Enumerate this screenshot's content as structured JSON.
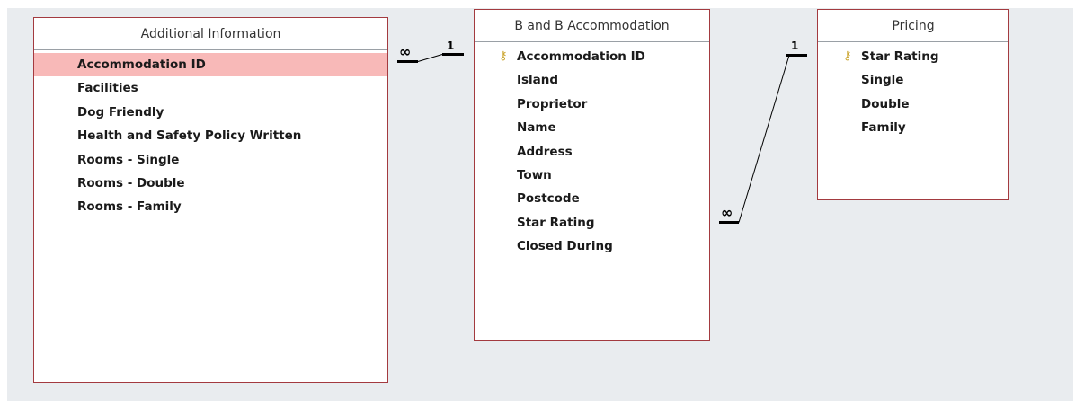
{
  "colors": {
    "canvas_bg": "#e9ecef",
    "table_border": "#a33a3f",
    "selected_row": "#f8b9b8",
    "key_icon": "#c9a227"
  },
  "tables": [
    {
      "title": "Additional Information",
      "fields": [
        {
          "name": "Accommodation ID",
          "selected": true
        },
        {
          "name": "Facilities"
        },
        {
          "name": "Dog Friendly"
        },
        {
          "name": "Health and Safety Policy Written"
        },
        {
          "name": "Rooms - Single"
        },
        {
          "name": "Rooms - Double"
        },
        {
          "name": "Rooms - Family"
        }
      ]
    },
    {
      "title": "B and B Accommodation",
      "fields": [
        {
          "name": "Accommodation ID",
          "primary_key": true,
          "icon": "key-icon"
        },
        {
          "name": "Island"
        },
        {
          "name": "Proprietor"
        },
        {
          "name": "Name"
        },
        {
          "name": "Address"
        },
        {
          "name": "Town"
        },
        {
          "name": "Postcode"
        },
        {
          "name": "Star Rating"
        },
        {
          "name": "Closed During"
        }
      ]
    },
    {
      "title": "Pricing",
      "fields": [
        {
          "name": "Star Rating",
          "primary_key": true,
          "icon": "key-icon"
        },
        {
          "name": "Single"
        },
        {
          "name": "Double"
        },
        {
          "name": "Family"
        }
      ]
    }
  ],
  "relationships": [
    {
      "from_table": "Additional Information",
      "from_field": "Accommodation ID",
      "from_cardinality": "∞",
      "to_table": "B and B Accommodation",
      "to_field": "Accommodation ID",
      "to_cardinality": "1"
    },
    {
      "from_table": "B and B Accommodation",
      "from_field": "Star Rating",
      "from_cardinality": "∞",
      "to_table": "Pricing",
      "to_field": "Star Rating",
      "to_cardinality": "1"
    }
  ]
}
